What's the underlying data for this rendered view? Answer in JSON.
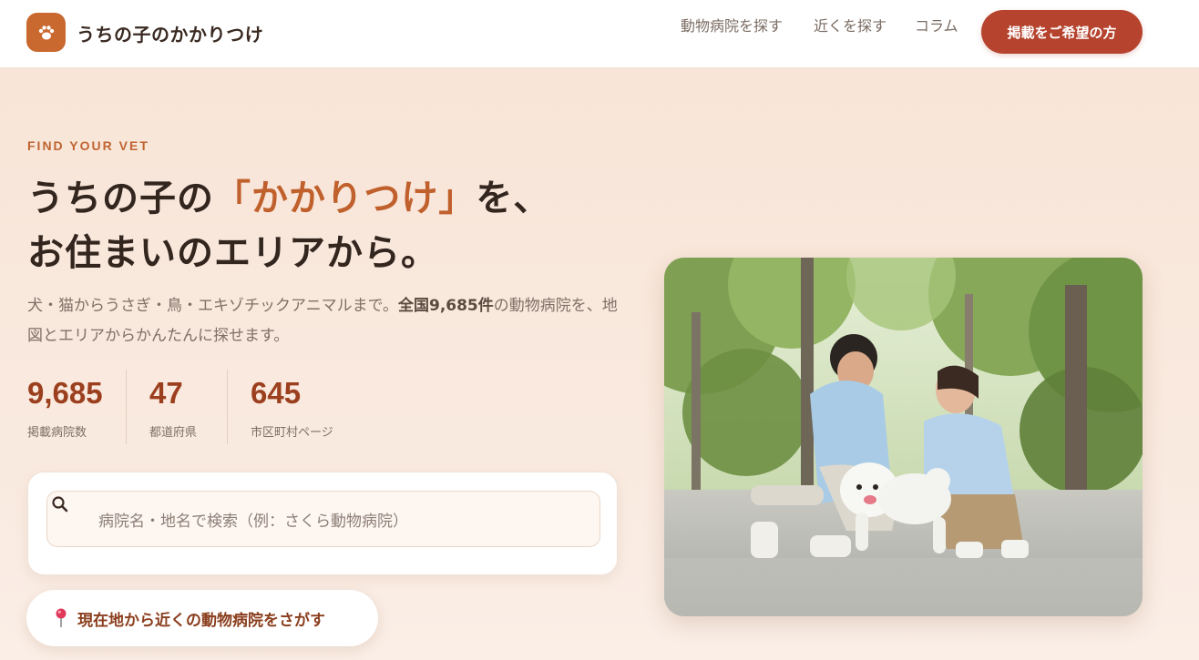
{
  "header": {
    "logo_icon": "paw-icon",
    "brand": "うちの子のかかりつけ",
    "nav": [
      "動物病院を探す",
      "近くを探す",
      "コラム"
    ],
    "cta_label": "掲載をご希望の方"
  },
  "hero": {
    "eyebrow": "FIND YOUR VET",
    "headline_pre": "うちの子の",
    "headline_accent": "「かかりつけ」",
    "headline_post": "を、",
    "headline_line2": "お住まいのエリアから。",
    "lead_1": "犬・猫からうさぎ・鳥・エキゾチックアニマルまで。",
    "lead_bold": "全国9,685件",
    "lead_2": "の動物病院を、地図とエリアからかんたんに探せます。",
    "stats": [
      {
        "value": "9,685",
        "label": "掲載病院数"
      },
      {
        "value": "47",
        "label": "都道府県"
      },
      {
        "value": "645",
        "label": "市区町村ページ"
      }
    ],
    "search_placeholder": "病院名・地名で検索（例：さくら動物病院）",
    "geo_button_label": "現在地から近くの動物病院をさがす",
    "geo_icon": "map-pin-icon",
    "photo": "couple-with-white-dog-photo"
  },
  "colors": {
    "accent": "#c0602c",
    "cta": "#b5432e",
    "stat": "#9b3f1e"
  }
}
